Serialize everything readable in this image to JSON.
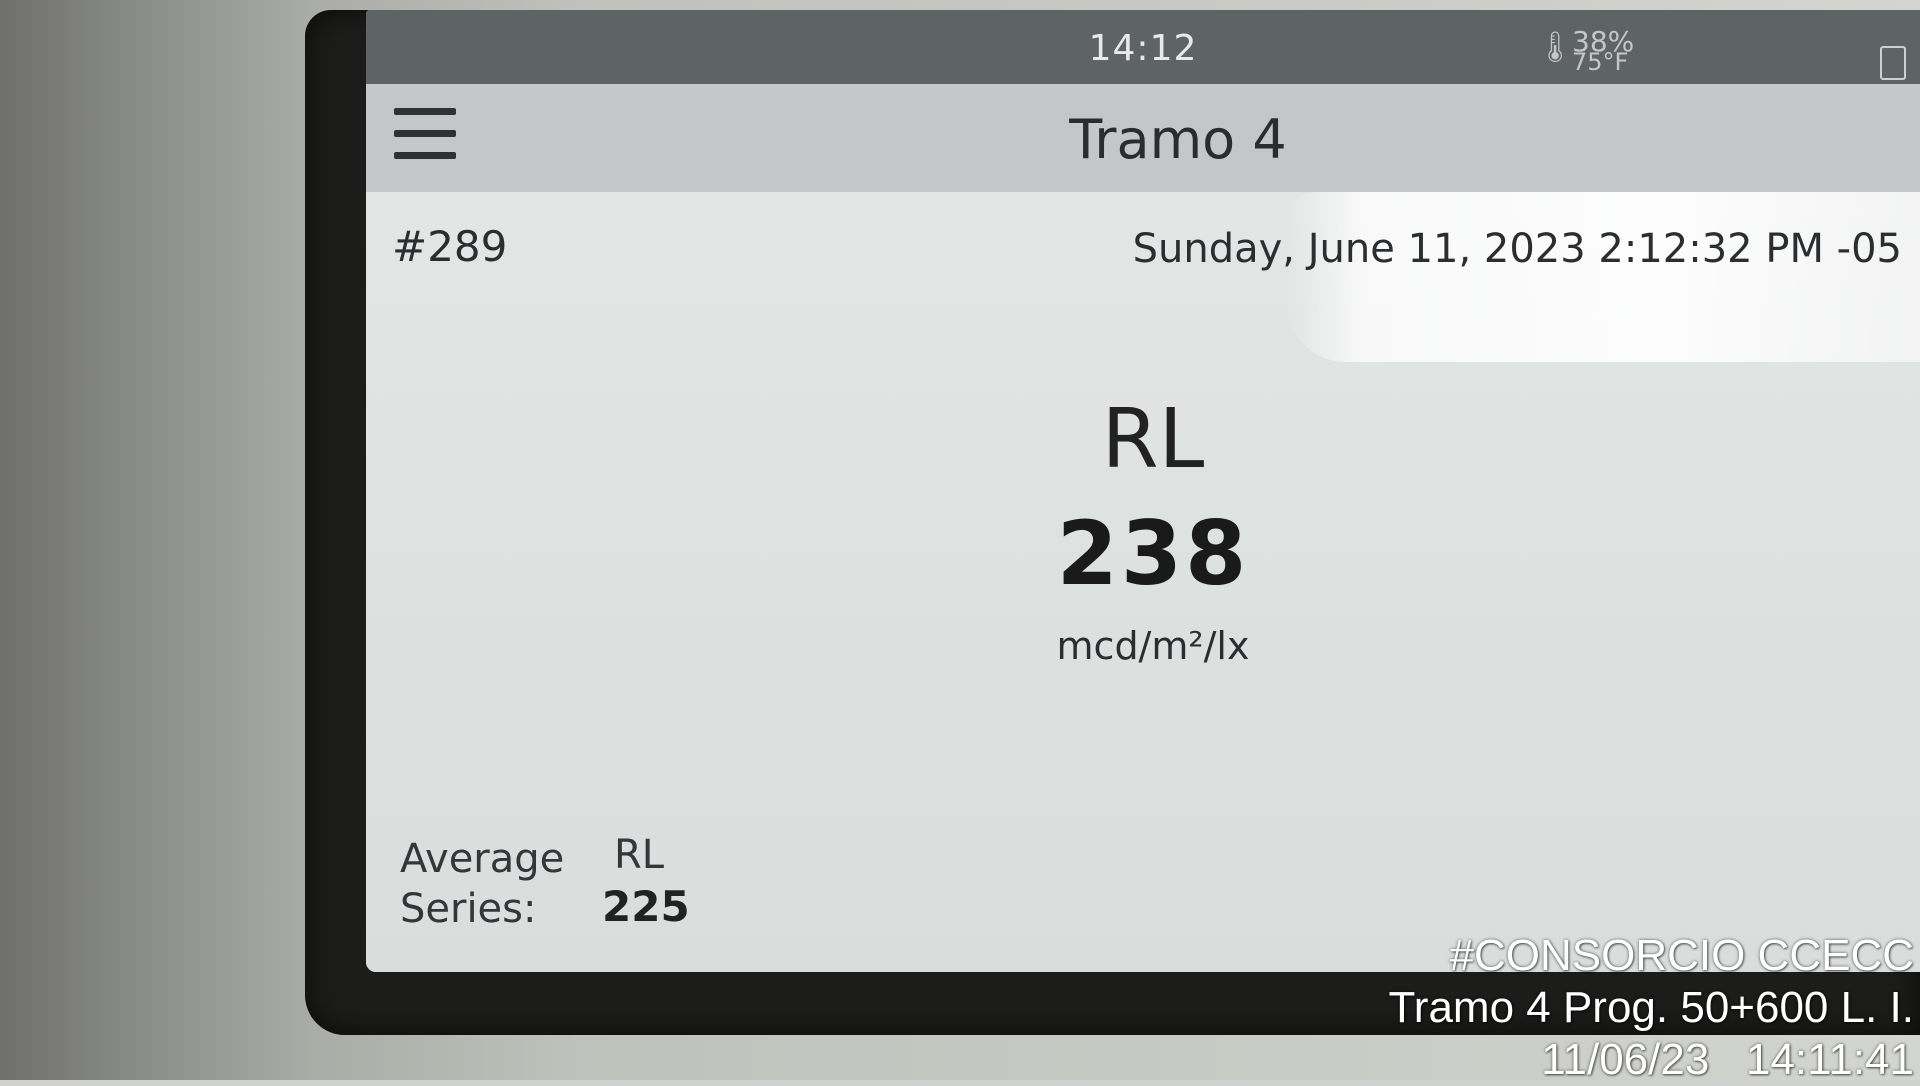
{
  "statusbar": {
    "time": "14:12",
    "humidity": "38%",
    "temperature": "75°F",
    "thermometer_icon": "thermometer-icon",
    "battery_icon": "battery-icon"
  },
  "appbar": {
    "menu_icon": "hamburger-menu-icon",
    "title": "Tramo 4"
  },
  "measurement": {
    "record_id": "#289",
    "datetime": "Sunday, June 11, 2023 2:12:32 PM -05",
    "metric_label": "RL",
    "metric_value": "238",
    "metric_unit": "mcd/m²/lx"
  },
  "average": {
    "label_line1": "Average",
    "label_line2": "Series:",
    "metric_label": "RL",
    "value": "225"
  },
  "photo_watermark": {
    "line1": "#CONSORCIO CCECC",
    "line2": "Tramo 4 Prog. 50+600 L. I.",
    "line3": "11/06/23   14:11:41"
  },
  "colors": {
    "statusbar_bg": "#5e6366",
    "appbar_bg": "#c4c7c9",
    "screen_bg": "#dfe1df"
  }
}
